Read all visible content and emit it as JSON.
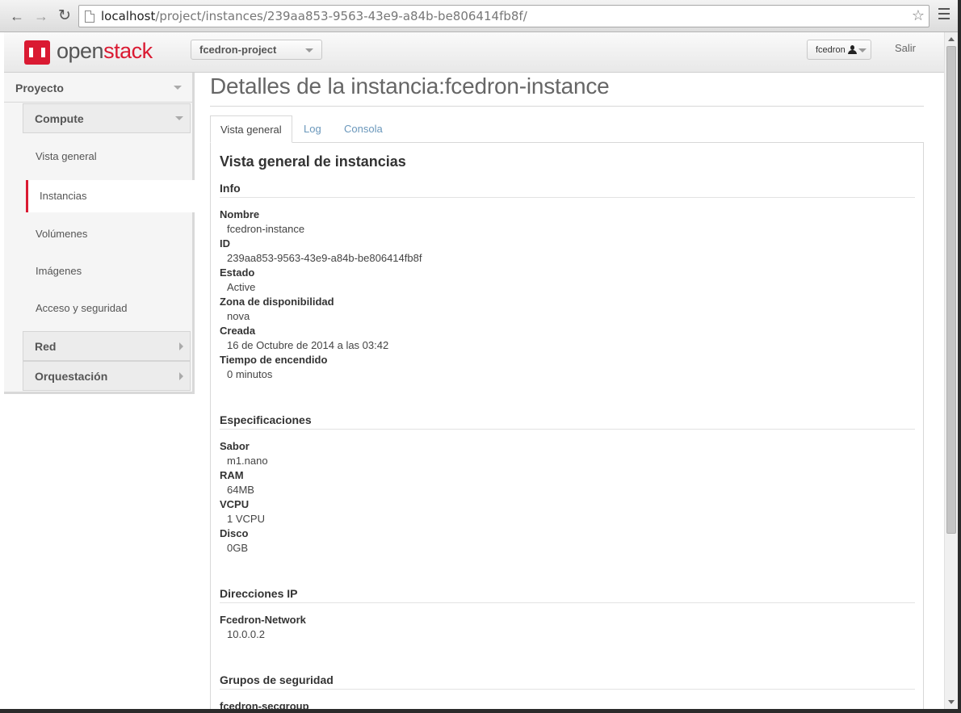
{
  "browser": {
    "url_host": "localhost",
    "url_path": "/project/instances/239aa853-9563-43e9-a84b-be806414fb8f/"
  },
  "header": {
    "logo_open": "open",
    "logo_stack": "stack",
    "project": "fcedron-project",
    "user": "fcedron",
    "logout": "Salir"
  },
  "sidebar": {
    "project": "Proyecto",
    "compute": "Compute",
    "items": [
      {
        "label": "Vista general"
      },
      {
        "label": "Instancias"
      },
      {
        "label": "Volúmenes"
      },
      {
        "label": "Imágenes"
      },
      {
        "label": "Acceso y seguridad"
      }
    ],
    "red": "Red",
    "orquestacion": "Orquestación"
  },
  "main": {
    "title": "Detalles de la instancia:fcedron-instance",
    "tabs": [
      {
        "label": "Vista general"
      },
      {
        "label": "Log"
      },
      {
        "label": "Consola"
      }
    ],
    "overview_title": "Vista general de instancias",
    "info": {
      "heading": "Info",
      "fields": [
        {
          "label": "Nombre",
          "value": "fcedron-instance"
        },
        {
          "label": "ID",
          "value": "239aa853-9563-43e9-a84b-be806414fb8f"
        },
        {
          "label": "Estado",
          "value": "Active"
        },
        {
          "label": "Zona de disponibilidad",
          "value": "nova"
        },
        {
          "label": "Creada",
          "value": "16 de Octubre de 2014 a las 03:42"
        },
        {
          "label": "Tiempo de encendido",
          "value": "0 minutos"
        }
      ]
    },
    "specs": {
      "heading": "Especificaciones",
      "fields": [
        {
          "label": "Sabor",
          "value": "m1.nano"
        },
        {
          "label": "RAM",
          "value": "64MB"
        },
        {
          "label": "VCPU",
          "value": "1 VCPU"
        },
        {
          "label": "Disco",
          "value": "0GB"
        }
      ]
    },
    "ip": {
      "heading": "Direcciones IP",
      "network": "Fcedron-Network",
      "address": "10.0.0.2"
    },
    "security": {
      "heading": "Grupos de seguridad",
      "group": "fcedron-secgroup"
    }
  }
}
